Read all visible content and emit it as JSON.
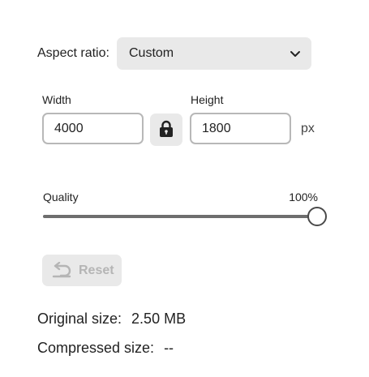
{
  "aspect": {
    "label": "Aspect ratio:",
    "selected": "Custom",
    "icon": "chevron-down-icon"
  },
  "dimensions": {
    "width_label": "Width",
    "width_value": "4000",
    "height_label": "Height",
    "height_value": "1800",
    "unit": "px",
    "lock_icon": "lock-icon",
    "locked": true
  },
  "quality": {
    "label": "Quality",
    "value_text": "100%",
    "value": 100
  },
  "reset": {
    "label": "Reset",
    "icon": "undo-icon",
    "enabled": false
  },
  "info": {
    "original_label": "Original size:",
    "original_value": "2.50 MB",
    "compressed_label": "Compressed size:",
    "compressed_value": "--"
  },
  "colors": {
    "control_bg": "#e9e9e9",
    "input_border": "#b8b8b8",
    "text": "#222222",
    "disabled_text": "#b5b5b5",
    "slider_fill": "#6e6e6e"
  }
}
